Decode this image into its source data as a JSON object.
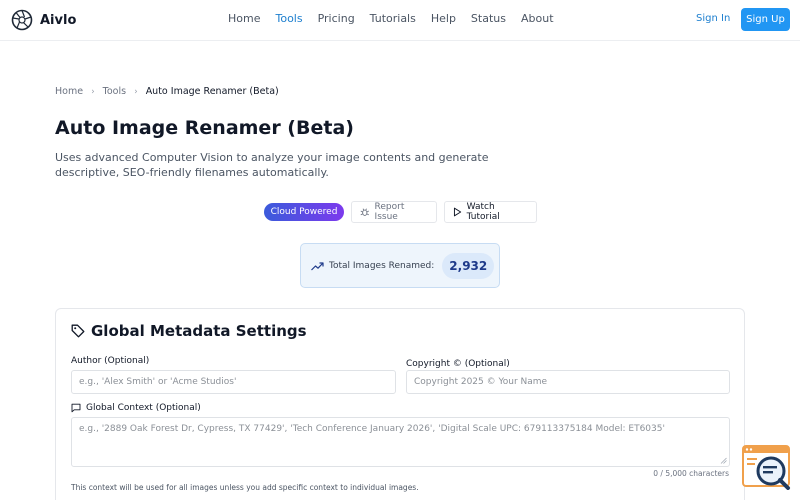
{
  "header": {
    "brand": "Aivlo",
    "nav": [
      {
        "label": "Home",
        "active": false
      },
      {
        "label": "Tools",
        "active": true
      },
      {
        "label": "Pricing",
        "active": false
      },
      {
        "label": "Tutorials",
        "active": false
      },
      {
        "label": "Help",
        "active": false
      },
      {
        "label": "Status",
        "active": false
      },
      {
        "label": "About",
        "active": false
      }
    ],
    "sign_in": "Sign In",
    "sign_up": "Sign Up"
  },
  "breadcrumb": {
    "home": "Home",
    "tools": "Tools",
    "current": "Auto Image Renamer (Beta)",
    "separator": "›"
  },
  "page": {
    "title": "Auto Image Renamer (Beta)",
    "description": "Uses advanced Computer Vision to analyze your image contents and generate descriptive, SEO-friendly filenames automatically."
  },
  "actions": {
    "cloud_badge": "Cloud Powered",
    "report_issue": "Report Issue",
    "watch_tutorial": "Watch Tutorial"
  },
  "stats": {
    "label": "Total Images Renamed:",
    "value": "2,932"
  },
  "settings": {
    "title": "Global Metadata Settings",
    "author_label": "Author (Optional)",
    "author_placeholder": "e.g., 'Alex Smith' or 'Acme Studios'",
    "author_value": "",
    "copyright_label": "Copyright © (Optional)",
    "copyright_placeholder": "Copyright 2025 © Your Name",
    "copyright_value": "",
    "context_label": "Global Context (Optional)",
    "context_placeholder": "e.g., '2889 Oak Forest Dr, Cypress, TX 77429', 'Tech Conference January 2026', 'Digital Scale UPC: 679113375184 Model: ET6035'",
    "context_value": "",
    "counter": "0 / 5,000 characters",
    "help": "This context will be used for all images unless you add specific context to individual images."
  },
  "colors": {
    "accent": "#2196f3",
    "link": "#1d7fcf",
    "badge_gradient_start": "#3b5bdb",
    "badge_gradient_end": "#7c3aed",
    "stat_bg": "#eef5fc",
    "stat_value": "#1e3a8a",
    "widget_orange": "#f0a04b",
    "widget_navy": "#1f3a5f"
  },
  "icons": {
    "logo": "aperture-logo-icon",
    "breadcrumb_separator": "chevron-right-icon",
    "report": "bug-icon",
    "tutorial": "play-icon",
    "stats": "trending-up-icon",
    "settings": "tag-icon",
    "context": "message-square-icon",
    "chat": "chat-search-widget-icon"
  }
}
